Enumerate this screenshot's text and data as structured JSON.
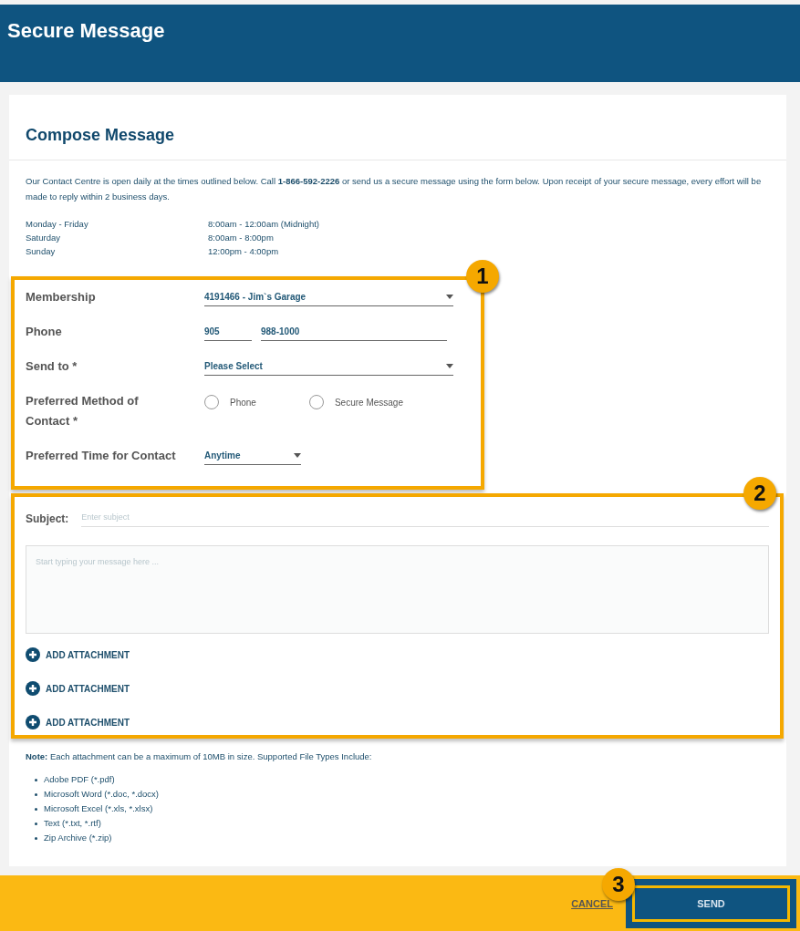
{
  "header": {
    "title": "Secure Message"
  },
  "compose": {
    "title": "Compose Message",
    "intro": "Our Contact Centre is open daily at the times outlined below. Call **1-866-592-2226** or send us a secure message using the form below. Upon receipt of your secure message, every effort will be made to reply within 2 business days.",
    "hours": [
      {
        "days": "Monday - Friday",
        "time": "8:00am - 12:00am (Midnight)"
      },
      {
        "days": "Saturday",
        "time": "8:00am - 8:00pm"
      },
      {
        "days": "Sunday",
        "time": "12:00pm - 4:00pm"
      }
    ]
  },
  "contact_form": {
    "callout": "1",
    "fields": [
      {
        "kind": "select",
        "label": "Membership",
        "value": "4191466 - Jim`s Garage"
      },
      {
        "kind": "phone",
        "label": "Phone",
        "values": [
          "905",
          "988-1000"
        ]
      },
      {
        "kind": "select",
        "label": "Send to *",
        "value": "Please Select"
      },
      {
        "kind": "radio",
        "label": "Preferred Method of Contact *",
        "options": [
          {
            "label": "Phone",
            "selected": false
          },
          {
            "label": "Secure Message",
            "selected": false
          }
        ]
      },
      {
        "kind": "short-select",
        "label": "Preferred Time for Contact",
        "value": "Anytime"
      }
    ]
  },
  "message_form": {
    "callout": "2",
    "subject_label": "Subject:",
    "subject_placeholder": "Enter subject",
    "body_placeholder": "Start typing your message here ...",
    "attachments": [
      "ADD ATTACHMENT",
      "ADD ATTACHMENT",
      "ADD ATTACHMENT"
    ]
  },
  "note": {
    "text": "**Note:** Each attachment can be a maximum of 10MB in size. Supported File Types Include:",
    "file_types": [
      "Adobe PDF (*.pdf)",
      "Microsoft Word (*.doc, *.docx)",
      "Microsoft Excel (*.xls, *.xlsx)",
      "Text (*.txt, *.rtf)",
      "Zip Archive (*.zip)"
    ]
  },
  "footer": {
    "cancel": "CANCEL",
    "send": "SEND",
    "callout": "3"
  }
}
